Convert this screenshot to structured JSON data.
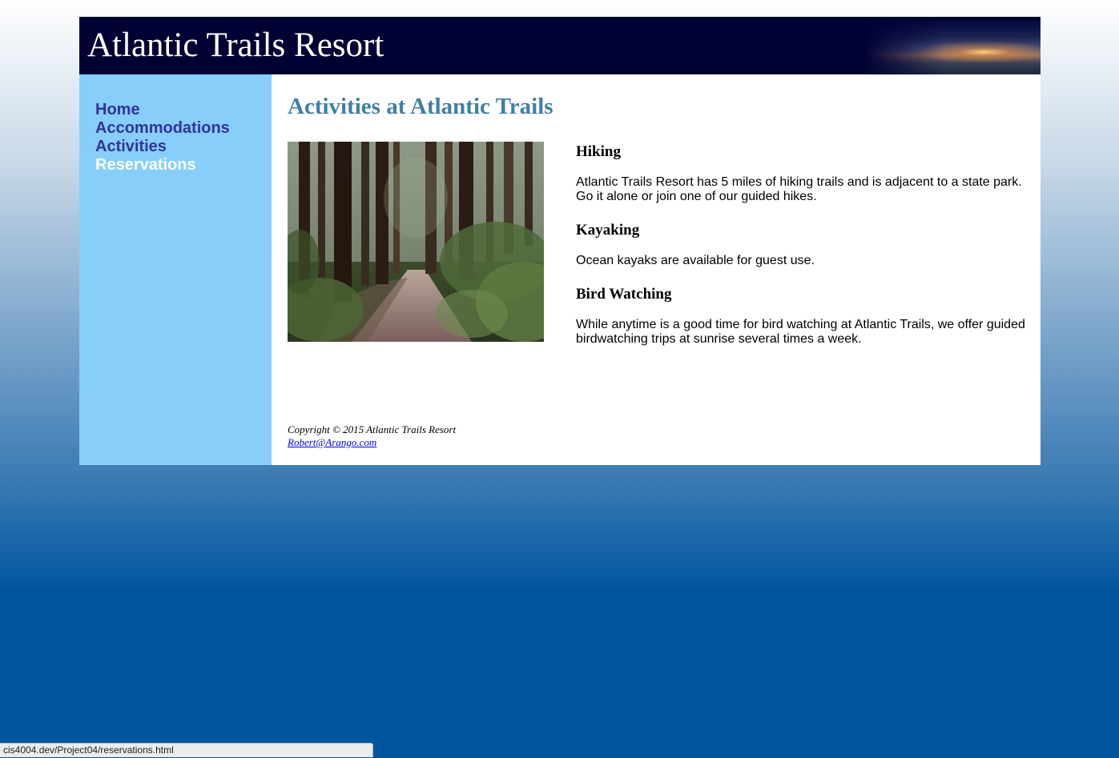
{
  "header": {
    "site_title": "Atlantic Trails Resort"
  },
  "nav": {
    "items": [
      {
        "label": "Home"
      },
      {
        "label": "Accommodations"
      },
      {
        "label": "Activities"
      },
      {
        "label": "Reservations",
        "state": "hover"
      }
    ],
    "link_color": "#333399",
    "hover_color": "#ffffff",
    "background": "#87cefa"
  },
  "main": {
    "heading": "Activities at Atlantic Trails",
    "heading_color": "#3f7fa6",
    "image": {
      "subject": "forest trail photo"
    },
    "activities": [
      {
        "title": "Hiking",
        "description": "Atlantic Trails Resort has 5 miles of hiking trails and is adjacent to a state park. Go it alone or join one of our guided hikes."
      },
      {
        "title": "Kayaking",
        "description": "Ocean kayaks are available for guest use."
      },
      {
        "title": "Bird Watching",
        "description": "While anytime is a good time for bird watching at Atlantic Trails, we offer guided birdwatching trips at sunrise several times a week."
      }
    ]
  },
  "footer": {
    "copyright": "Copyright © 2015 Atlantic Trails Resort",
    "email": "Robert@Arango.com"
  },
  "statusbar": {
    "url": "cis4004.dev/Project04/reservations.html"
  },
  "colors": {
    "header_bg": "#000033",
    "page_gradient_bottom": "#00559f"
  }
}
